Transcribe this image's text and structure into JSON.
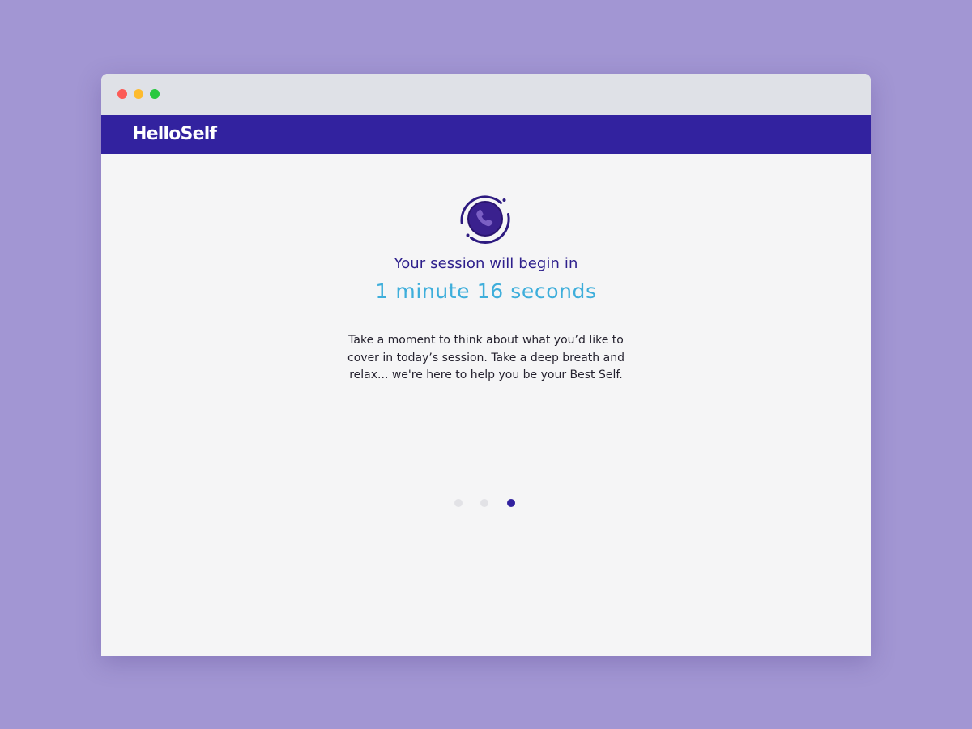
{
  "window": {
    "traffic_lights": {
      "close_color": "#fc5b57",
      "minimize_color": "#fdbb2e",
      "maximize_color": "#28c840"
    }
  },
  "header": {
    "brand": "HelloSelf",
    "background_color": "#32229f"
  },
  "main": {
    "icon": "phone-icon",
    "heading": "Your session will begin in",
    "countdown": "1 minute 16 seconds",
    "message": "Take a moment to think about what you’d like to cover in today’s session. Take a deep breath and relax... we're here to help you be your Best Self.",
    "accent_color": "#3eaedb",
    "heading_color": "#2d1f8c"
  },
  "pager": {
    "total": 3,
    "active_index": 2
  }
}
